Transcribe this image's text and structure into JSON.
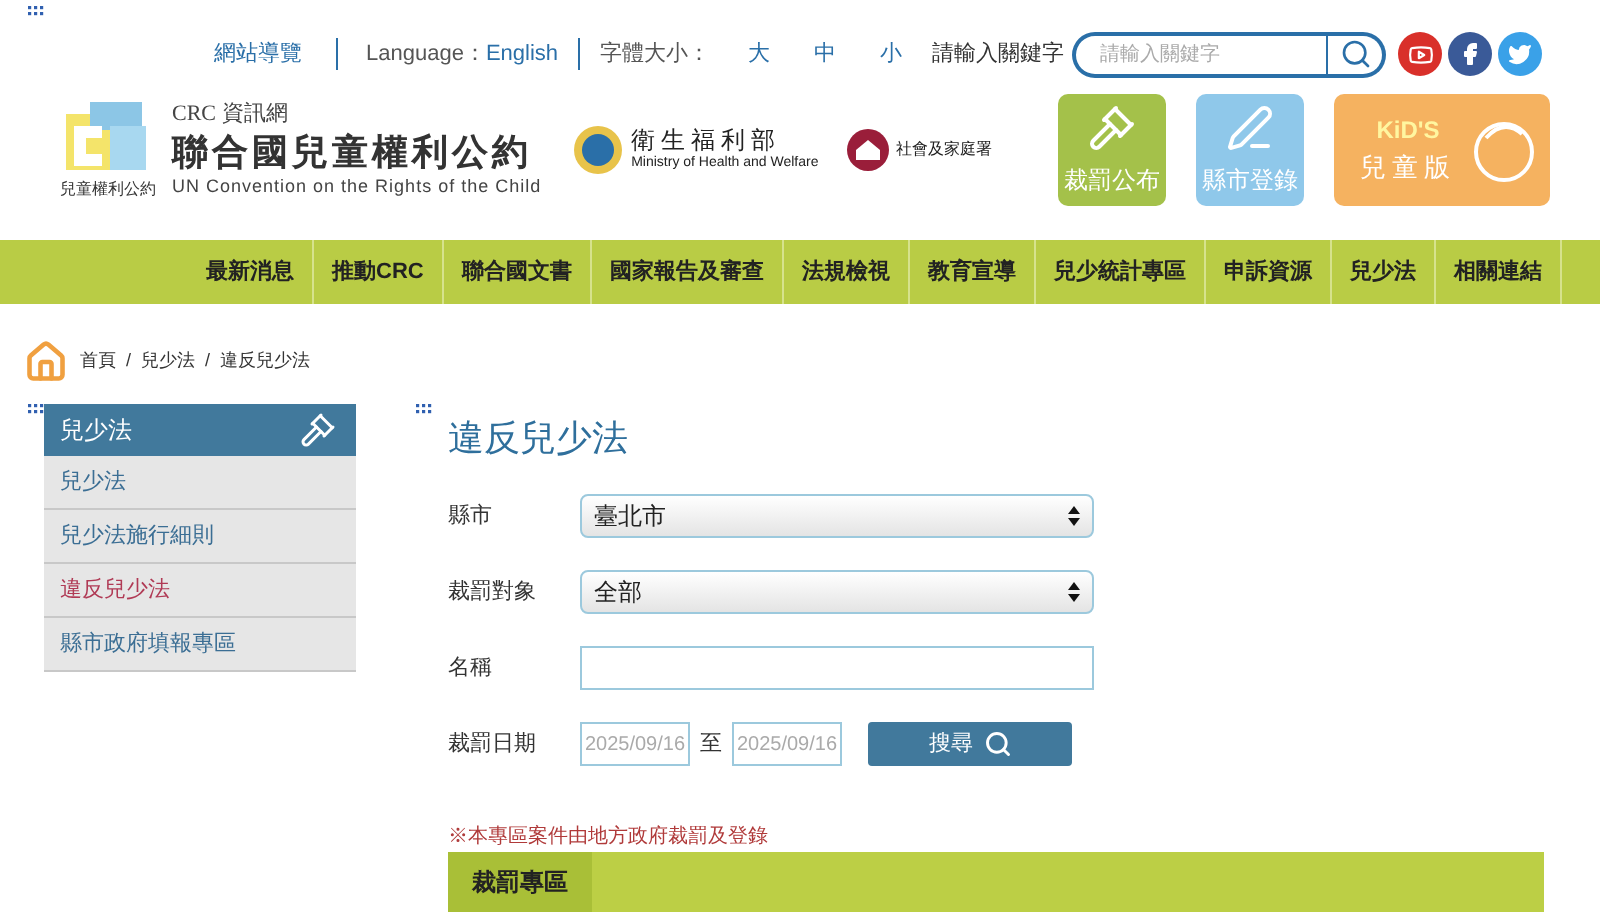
{
  "top_links": {
    "sitemap": "網站導覽",
    "language_label": "Language：",
    "language_value": "English",
    "font_size_label": "字體大小：",
    "font_sizes": [
      {
        "label": "大",
        "selected": false
      },
      {
        "label": "中",
        "selected": false
      },
      {
        "label": "小",
        "selected": false
      }
    ],
    "search_label": "請輸入關鍵字",
    "search_placeholder": "請輸入關鍵字"
  },
  "brand": {
    "logo_caption": "兒童權利公約",
    "subtitle": "CRC 資訊網",
    "title": "聯合國兒童權利公約",
    "english": "UN Convention on the Rights of the Child"
  },
  "partners": {
    "ministry_name": "衛生福利部",
    "ministry_english": "Ministry of Health and Welfare",
    "agency_name": "社會及家庭署"
  },
  "quick_buttons": [
    {
      "kind": "gavel",
      "label": "裁罰公布",
      "color": "#a4c14a"
    },
    {
      "kind": "pen",
      "label": "縣市登錄",
      "color": "#8fc8ea"
    }
  ],
  "kids_button": {
    "badge": "KiD'S",
    "label": "兒童版"
  },
  "nav": [
    "最新消息",
    "推動CRC",
    "聯合國文書",
    "國家報告及審查",
    "法規檢視",
    "教育宣導",
    "兒少統計專區",
    "申訴資源",
    "兒少法",
    "相關連結"
  ],
  "breadcrumb": {
    "separator": "/",
    "items": [
      "首頁",
      "兒少法",
      "違反兒少法"
    ]
  },
  "sidebar": {
    "title": "兒少法",
    "items": [
      {
        "label": "兒少法",
        "selected": false
      },
      {
        "label": "兒少法施行細則",
        "selected": false
      },
      {
        "label": "違反兒少法",
        "selected": true
      },
      {
        "label": "縣市政府填報專區",
        "selected": false
      }
    ]
  },
  "page_title": "違反兒少法",
  "form": {
    "county_label": "縣市",
    "county_value": "臺北市",
    "target_label": "裁罰對象",
    "target_value": "全部",
    "name_label": "名稱",
    "date_label": "裁罰日期",
    "date_from": "2025/09/16",
    "date_sep": "至",
    "date_to": "2025/09/16",
    "search_button": "搜尋"
  },
  "note": "※本專區案件由地方政府裁罰及登錄",
  "section_tab": "裁罰專區"
}
